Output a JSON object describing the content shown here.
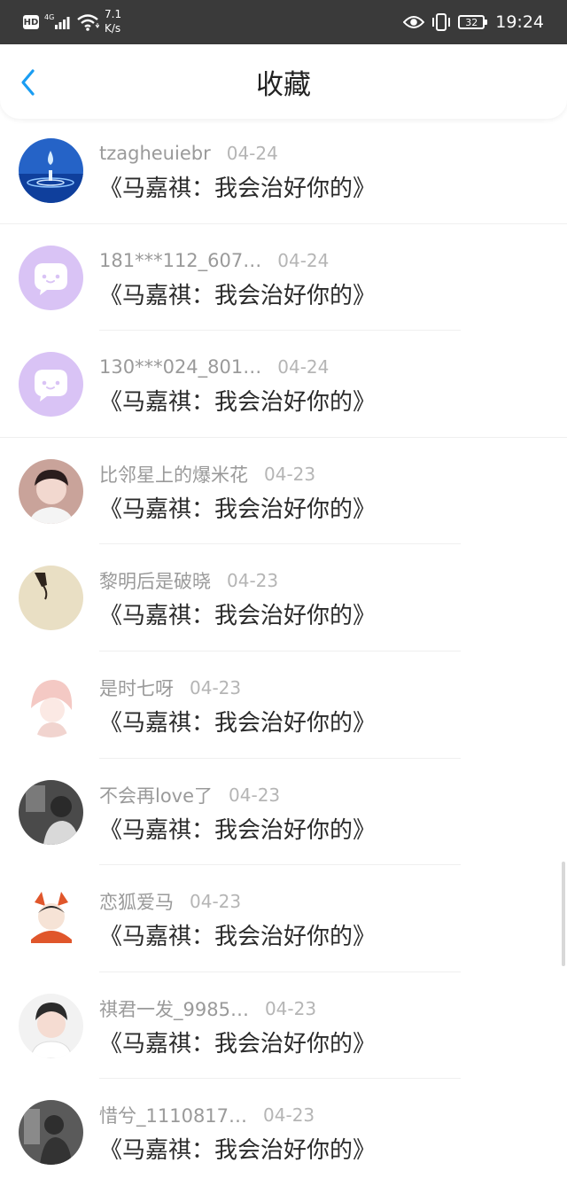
{
  "status_bar": {
    "hd": "HD",
    "network": "4G",
    "speed_value": "7.1",
    "speed_unit": "K/s",
    "battery": "32",
    "time": "19:24"
  },
  "nav": {
    "title": "收藏"
  },
  "items": [
    {
      "username": "tzagheuiebr",
      "date": "04-24",
      "title": "《马嘉祺：我会治好你的》"
    },
    {
      "username": "181***112_607…",
      "date": "04-24",
      "title": "《马嘉祺：我会治好你的》"
    },
    {
      "username": "130***024_801…",
      "date": "04-24",
      "title": "《马嘉祺：我会治好你的》"
    },
    {
      "username": "比邻星上的爆米花",
      "date": "04-23",
      "title": "《马嘉祺：我会治好你的》"
    },
    {
      "username": "黎明后是破晓",
      "date": "04-23",
      "title": "《马嘉祺：我会治好你的》"
    },
    {
      "username": "是时七呀",
      "date": "04-23",
      "title": "《马嘉祺：我会治好你的》"
    },
    {
      "username": "不会再love了",
      "date": "04-23",
      "title": "《马嘉祺：我会治好你的》"
    },
    {
      "username": "恋狐爱马",
      "date": "04-23",
      "title": "《马嘉祺：我会治好你的》"
    },
    {
      "username": "祺君一发_9985…",
      "date": "04-23",
      "title": "《马嘉祺：我会治好你的》"
    },
    {
      "username": "惜兮_1110817…",
      "date": "04-23",
      "title": "《马嘉祺：我会治好你的》"
    }
  ],
  "colors": {
    "accent": "#1a9df2",
    "status_bar_bg": "#3a3a3a",
    "default_avatar": "#d9c3f5"
  }
}
